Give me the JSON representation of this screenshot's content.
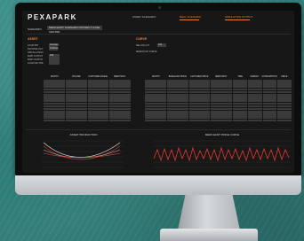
{
  "app": {
    "logo": "PEXAPARK",
    "tabs": [
      {
        "label": "ASSET SCENARIO",
        "active": false
      },
      {
        "label": "REAL SCENARIO",
        "active": true
      },
      {
        "label": "SIMULATION OUTPUT",
        "active": true
      }
    ],
    "accent_color": "#e8823a"
  },
  "scenario": {
    "label": "SCENARIO",
    "value": "MERCHANT SCENARIO PROJECT CASE CENTRE"
  },
  "sections": {
    "asset": {
      "title": "ASSET",
      "fields": [
        {
          "label": "COUNTRY",
          "value": "Germany"
        },
        {
          "label": "TECHNOLOGY",
          "value": "Onshore"
        },
        {
          "label": "INSTALLATION",
          "value": ""
        },
        {
          "label": "MWP OUTPUT",
          "value": "100"
        },
        {
          "label": "MWH OUTPUT",
          "value": ""
        },
        {
          "label": "LOAD FACTOR",
          "value": ""
        }
      ]
    },
    "curve": {
      "title": "CURVE",
      "fields": [
        {
          "label": "SELLING FIT",
          "value": "100"
        },
        {
          "label": "MERCHANT CURVE",
          "value": ""
        }
      ]
    }
  },
  "tables": {
    "asset_table": {
      "headers": [
        "MONTH",
        "VOLUME",
        "CAPTURED RANGE",
        "MERCHANT"
      ]
    },
    "curve_table": {
      "headers": [
        "MONTH",
        "BASELOAD PRICE",
        "CAPTURED PRICE",
        "MERCHANT"
      ]
    },
    "output_table": {
      "headers": [
        "TIME",
        "MARKET",
        "CONSUMPTION",
        "PRICE"
      ]
    }
  },
  "charts": {
    "left_title": "ASSET PRODUCTION",
    "right_title": "MERCHANT PRICE CURVE"
  }
}
